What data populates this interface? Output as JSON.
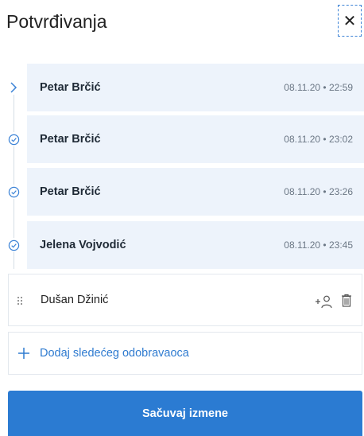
{
  "header": {
    "title": "Potvrđivanja",
    "close_icon": "close-icon"
  },
  "confirmations": [
    {
      "name": "Petar Brčić",
      "datetime": "08.11.20 • 22:59",
      "status": "current",
      "icon": "chevron-right-icon"
    },
    {
      "name": "Petar Brčić",
      "datetime": "08.11.20 • 23:02",
      "status": "approved",
      "icon": "check-circle-icon"
    },
    {
      "name": "Petar Brčić",
      "datetime": "08.11.20 • 23:26",
      "status": "approved",
      "icon": "check-circle-icon"
    },
    {
      "name": "Jelena Vojvodić",
      "datetime": "08.11.20 • 23:45",
      "status": "approved",
      "icon": "check-circle-icon"
    }
  ],
  "pending_approver": {
    "name": "Dušan Džinić",
    "icons": [
      "drag-handle-icon",
      "add-user-icon",
      "trash-icon"
    ]
  },
  "add_approver": {
    "label": "Dodaj sledećeg odobravaoca",
    "icon": "plus-icon"
  },
  "save_button": {
    "label": "Sačuvaj izmene"
  },
  "colors": {
    "accent": "#2b7bd2",
    "row_bg": "#edf3fb",
    "link": "#2f7bd0",
    "icon": "#3b82d6"
  }
}
